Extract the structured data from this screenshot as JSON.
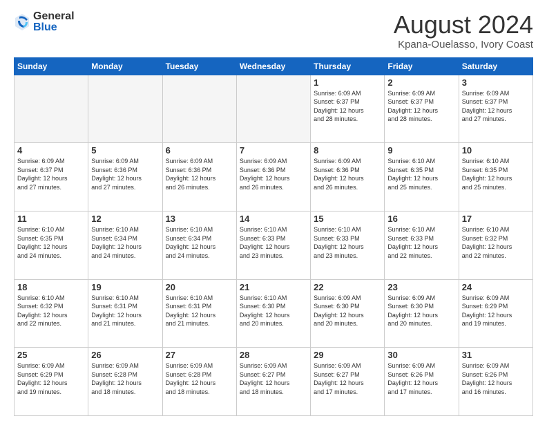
{
  "logo": {
    "general": "General",
    "blue": "Blue"
  },
  "title": "August 2024",
  "location": "Kpana-Ouelasso, Ivory Coast",
  "days_of_week": [
    "Sunday",
    "Monday",
    "Tuesday",
    "Wednesday",
    "Thursday",
    "Friday",
    "Saturday"
  ],
  "weeks": [
    [
      {
        "day": "",
        "info": ""
      },
      {
        "day": "",
        "info": ""
      },
      {
        "day": "",
        "info": ""
      },
      {
        "day": "",
        "info": ""
      },
      {
        "day": "1",
        "info": "Sunrise: 6:09 AM\nSunset: 6:37 PM\nDaylight: 12 hours\nand 28 minutes."
      },
      {
        "day": "2",
        "info": "Sunrise: 6:09 AM\nSunset: 6:37 PM\nDaylight: 12 hours\nand 28 minutes."
      },
      {
        "day": "3",
        "info": "Sunrise: 6:09 AM\nSunset: 6:37 PM\nDaylight: 12 hours\nand 27 minutes."
      }
    ],
    [
      {
        "day": "4",
        "info": "Sunrise: 6:09 AM\nSunset: 6:37 PM\nDaylight: 12 hours\nand 27 minutes."
      },
      {
        "day": "5",
        "info": "Sunrise: 6:09 AM\nSunset: 6:36 PM\nDaylight: 12 hours\nand 27 minutes."
      },
      {
        "day": "6",
        "info": "Sunrise: 6:09 AM\nSunset: 6:36 PM\nDaylight: 12 hours\nand 26 minutes."
      },
      {
        "day": "7",
        "info": "Sunrise: 6:09 AM\nSunset: 6:36 PM\nDaylight: 12 hours\nand 26 minutes."
      },
      {
        "day": "8",
        "info": "Sunrise: 6:09 AM\nSunset: 6:36 PM\nDaylight: 12 hours\nand 26 minutes."
      },
      {
        "day": "9",
        "info": "Sunrise: 6:10 AM\nSunset: 6:35 PM\nDaylight: 12 hours\nand 25 minutes."
      },
      {
        "day": "10",
        "info": "Sunrise: 6:10 AM\nSunset: 6:35 PM\nDaylight: 12 hours\nand 25 minutes."
      }
    ],
    [
      {
        "day": "11",
        "info": "Sunrise: 6:10 AM\nSunset: 6:35 PM\nDaylight: 12 hours\nand 24 minutes."
      },
      {
        "day": "12",
        "info": "Sunrise: 6:10 AM\nSunset: 6:34 PM\nDaylight: 12 hours\nand 24 minutes."
      },
      {
        "day": "13",
        "info": "Sunrise: 6:10 AM\nSunset: 6:34 PM\nDaylight: 12 hours\nand 24 minutes."
      },
      {
        "day": "14",
        "info": "Sunrise: 6:10 AM\nSunset: 6:33 PM\nDaylight: 12 hours\nand 23 minutes."
      },
      {
        "day": "15",
        "info": "Sunrise: 6:10 AM\nSunset: 6:33 PM\nDaylight: 12 hours\nand 23 minutes."
      },
      {
        "day": "16",
        "info": "Sunrise: 6:10 AM\nSunset: 6:33 PM\nDaylight: 12 hours\nand 22 minutes."
      },
      {
        "day": "17",
        "info": "Sunrise: 6:10 AM\nSunset: 6:32 PM\nDaylight: 12 hours\nand 22 minutes."
      }
    ],
    [
      {
        "day": "18",
        "info": "Sunrise: 6:10 AM\nSunset: 6:32 PM\nDaylight: 12 hours\nand 22 minutes."
      },
      {
        "day": "19",
        "info": "Sunrise: 6:10 AM\nSunset: 6:31 PM\nDaylight: 12 hours\nand 21 minutes."
      },
      {
        "day": "20",
        "info": "Sunrise: 6:10 AM\nSunset: 6:31 PM\nDaylight: 12 hours\nand 21 minutes."
      },
      {
        "day": "21",
        "info": "Sunrise: 6:10 AM\nSunset: 6:30 PM\nDaylight: 12 hours\nand 20 minutes."
      },
      {
        "day": "22",
        "info": "Sunrise: 6:09 AM\nSunset: 6:30 PM\nDaylight: 12 hours\nand 20 minutes."
      },
      {
        "day": "23",
        "info": "Sunrise: 6:09 AM\nSunset: 6:30 PM\nDaylight: 12 hours\nand 20 minutes."
      },
      {
        "day": "24",
        "info": "Sunrise: 6:09 AM\nSunset: 6:29 PM\nDaylight: 12 hours\nand 19 minutes."
      }
    ],
    [
      {
        "day": "25",
        "info": "Sunrise: 6:09 AM\nSunset: 6:29 PM\nDaylight: 12 hours\nand 19 minutes."
      },
      {
        "day": "26",
        "info": "Sunrise: 6:09 AM\nSunset: 6:28 PM\nDaylight: 12 hours\nand 18 minutes."
      },
      {
        "day": "27",
        "info": "Sunrise: 6:09 AM\nSunset: 6:28 PM\nDaylight: 12 hours\nand 18 minutes."
      },
      {
        "day": "28",
        "info": "Sunrise: 6:09 AM\nSunset: 6:27 PM\nDaylight: 12 hours\nand 18 minutes."
      },
      {
        "day": "29",
        "info": "Sunrise: 6:09 AM\nSunset: 6:27 PM\nDaylight: 12 hours\nand 17 minutes."
      },
      {
        "day": "30",
        "info": "Sunrise: 6:09 AM\nSunset: 6:26 PM\nDaylight: 12 hours\nand 17 minutes."
      },
      {
        "day": "31",
        "info": "Sunrise: 6:09 AM\nSunset: 6:26 PM\nDaylight: 12 hours\nand 16 minutes."
      }
    ]
  ]
}
